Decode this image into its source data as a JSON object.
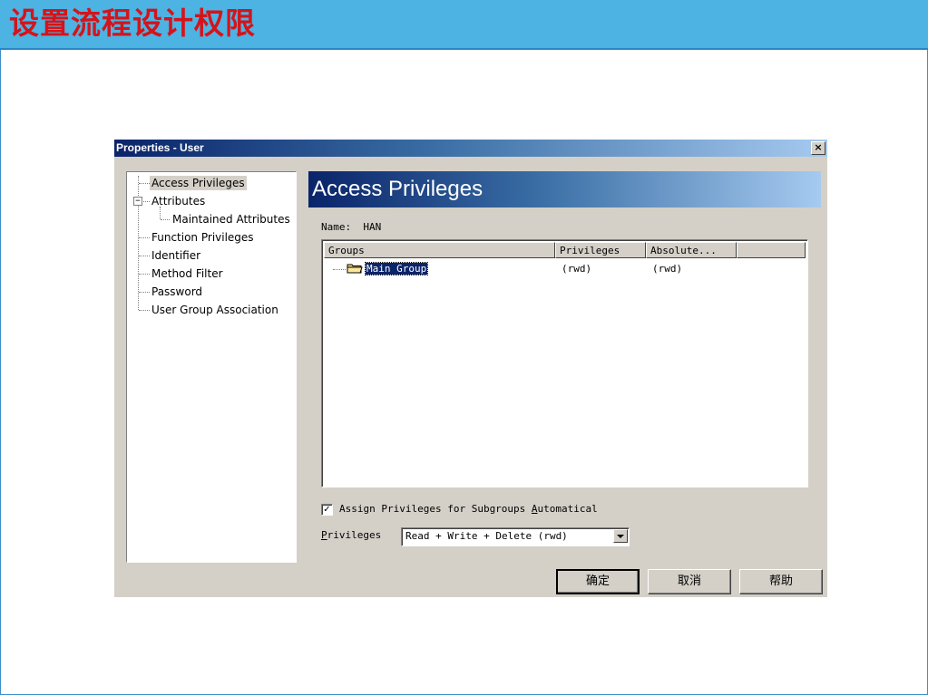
{
  "slide": {
    "title": "设置流程设计权限"
  },
  "dialog": {
    "title": "Properties - User",
    "close_glyph": "×"
  },
  "tree": {
    "items": [
      {
        "label": "Access Privileges"
      },
      {
        "label": "Attributes"
      },
      {
        "label": "Maintained Attributes"
      },
      {
        "label": "Function Privileges"
      },
      {
        "label": "Identifier"
      },
      {
        "label": "Method Filter"
      },
      {
        "label": "Password"
      },
      {
        "label": "User Group Association"
      }
    ],
    "expander_glyph": "−"
  },
  "page": {
    "heading": "Access Privileges",
    "name_label": "Name:",
    "name_value": "HAN"
  },
  "list": {
    "columns": [
      "Groups",
      "Privileges",
      "Absolute..."
    ],
    "rows": [
      {
        "group": "Main Group",
        "privileges": "(rwd)",
        "absolute": "(rwd)"
      }
    ]
  },
  "options": {
    "assign_checked": true,
    "check_glyph": "✓",
    "assign_label_pre": "Assign Privileges for Subgroups ",
    "assign_label_accel": "A",
    "assign_label_post": "utomatical",
    "privileges_label_accel": "P",
    "privileges_label_post": "rivileges",
    "privileges_value": "Read + Write + Delete (rwd)"
  },
  "buttons": {
    "ok": "确定",
    "cancel": "取消",
    "help": "帮助"
  },
  "colors": {
    "slide_header": "#4cb3e3",
    "slide_title": "#d4141a",
    "titlebar_start": "#0a246a",
    "titlebar_end": "#a6caf0",
    "dialog_face": "#d4d0c8",
    "selection": "#0a246a"
  },
  "icons": {
    "folder": "folder-icon",
    "close": "close-icon",
    "dropdown": "chevron-down-icon",
    "collapse": "minus-expander-icon"
  }
}
